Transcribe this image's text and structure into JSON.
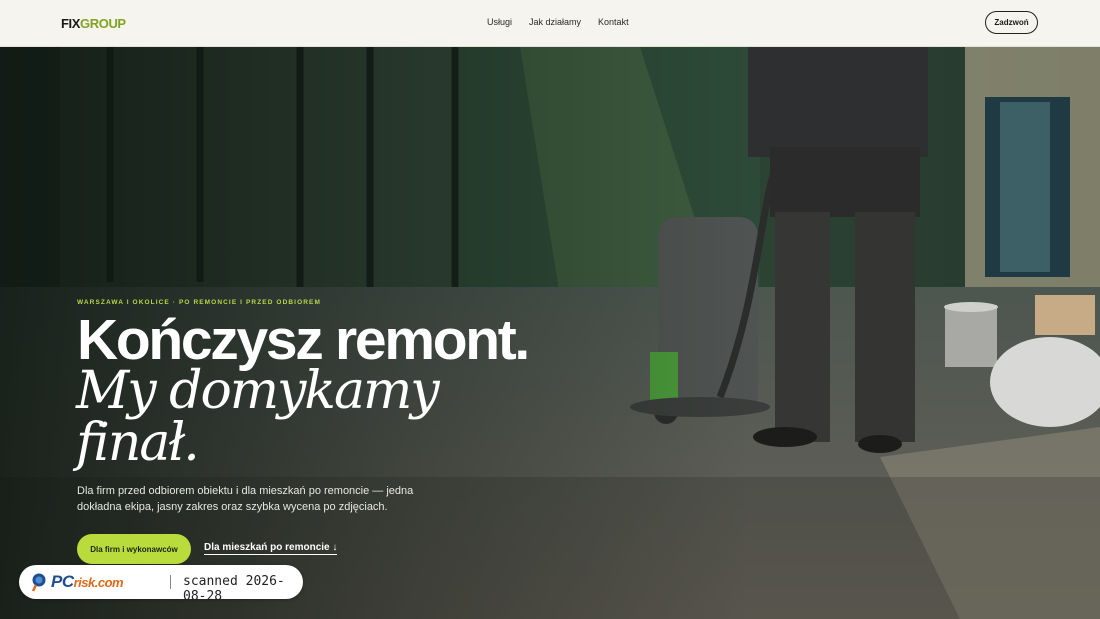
{
  "header": {
    "logo_part1": "FIX",
    "logo_part2": "GROUP",
    "nav": [
      "Usługi",
      "Jak działamy",
      "Kontakt"
    ],
    "call_label": "Zadzwoń"
  },
  "hero": {
    "eyebrow": "WARSZAWA I OKOLICE · PO REMONCIE I PRZED ODBIOREM",
    "title_line1": "Kończysz remont.",
    "title_line2": "My domykamy finał.",
    "lead": "Dla firm przed odbiorem obiektu i dla mieszkań po remoncie — jedna dokładna ekipa, jasny zakres oraz szybka wycena po zdjęciach.",
    "cta_primary": "Dla firm i wykonawców",
    "cta_secondary": "Dla mieszkań po remoncie ↓",
    "image": "worker-floor-cleaning-photo"
  },
  "stamp": {
    "brand": "PC",
    "brand_suffix": "risk.com",
    "scanned_text": "scanned 2026-08-28",
    "icon": "magnifier-logo-icon"
  },
  "colors": {
    "accent": "#b9dc3c",
    "logo_accent": "#7fa421",
    "header_bg": "#f5f4ee"
  }
}
